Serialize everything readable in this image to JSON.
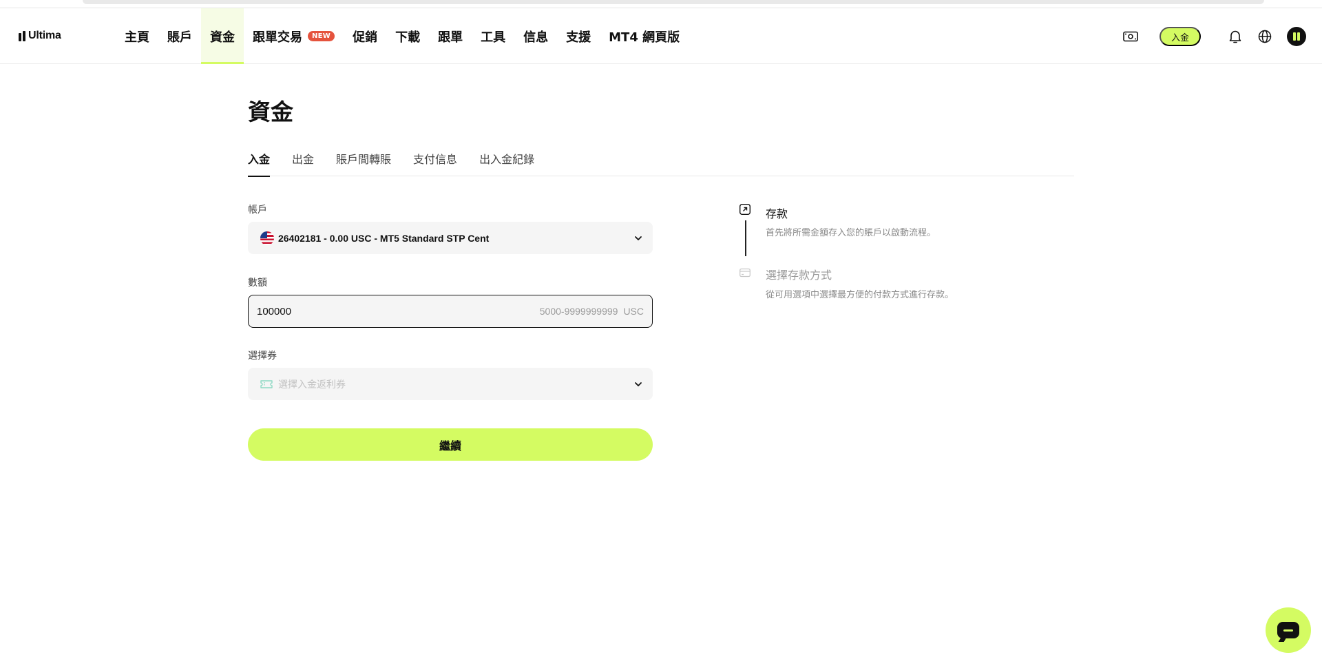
{
  "brand": {
    "name": "Ultima"
  },
  "nav": {
    "items": [
      {
        "label": "主頁"
      },
      {
        "label": "賬戶"
      },
      {
        "label": "資金",
        "active": true
      },
      {
        "label": "跟單交易",
        "badge": "NEW"
      },
      {
        "label": "促銷"
      },
      {
        "label": "下載"
      },
      {
        "label": "跟單"
      },
      {
        "label": "工具"
      },
      {
        "label": "信息"
      },
      {
        "label": "支援"
      },
      {
        "label": "MT4 網頁版"
      }
    ],
    "right": {
      "deposit_label": "入金",
      "icons": [
        "cash-icon",
        "bell-icon",
        "globe-icon",
        "avatar"
      ]
    }
  },
  "page": {
    "title": "資金"
  },
  "tabs": [
    {
      "label": "入金",
      "active": true
    },
    {
      "label": "出金"
    },
    {
      "label": "賬戶間轉賬"
    },
    {
      "label": "支付信息"
    },
    {
      "label": "出入金紀錄"
    }
  ],
  "form": {
    "account": {
      "label": "帳戶",
      "value": "26402181 - 0.00 USC - MT5 Standard STP Cent"
    },
    "amount": {
      "label": "數額",
      "value": "100000",
      "range_hint": "5000-9999999999",
      "unit": "USC"
    },
    "voucher": {
      "label": "選擇券",
      "placeholder": "選擇入金返利券"
    },
    "submit_label": "繼續"
  },
  "steps": [
    {
      "title": "存款",
      "description": "首先將所需金額存入您的賬戶以啟動流程。",
      "state": "current"
    },
    {
      "title": "選擇存款方式",
      "description": "從可用選項中選擇最方便的付款方式進行存款。",
      "state": "pending"
    }
  ],
  "colors": {
    "accent": "#d4fb62",
    "badge": "#e5533d",
    "text": "#111111",
    "muted": "#888888",
    "field_bg": "#f5f5f5"
  }
}
